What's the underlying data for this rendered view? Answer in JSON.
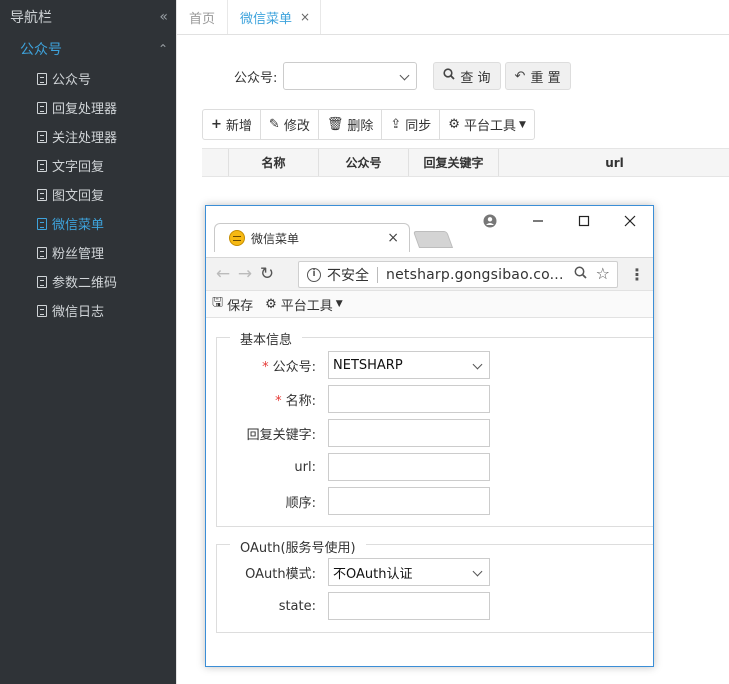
{
  "sidebar": {
    "title": "导航栏",
    "collapse_icon": "«",
    "group": "公众号",
    "group_icon": "chevron-double-up-icon",
    "items": [
      {
        "label": "公众号"
      },
      {
        "label": "回复处理器"
      },
      {
        "label": "关注处理器"
      },
      {
        "label": "文字回复"
      },
      {
        "label": "图文回复"
      },
      {
        "label": "微信菜单",
        "active": true
      },
      {
        "label": "粉丝管理"
      },
      {
        "label": "参数二维码"
      },
      {
        "label": "微信日志"
      }
    ]
  },
  "tabs": [
    {
      "label": "首页"
    },
    {
      "label": "微信菜单",
      "active": true,
      "close": "×"
    }
  ],
  "search": {
    "label": "公众号:",
    "select_value": "",
    "query_button": "查 询",
    "reset_button": "重 置"
  },
  "toolbar": {
    "add": "新增",
    "edit": "修改",
    "delete": "删除",
    "sync": "同步",
    "platform": "平台工具"
  },
  "grid": {
    "columns": [
      "名称",
      "公众号",
      "回复关键字",
      "url"
    ]
  },
  "popup": {
    "tab_title": "微信菜单",
    "tab_close": "×",
    "security": "不安全",
    "url": "netsharp.gongsibao.co...",
    "toolbar": {
      "save": "保存",
      "platform": "平台工具"
    },
    "basic_legend": "基本信息",
    "fields": [
      {
        "label": "公众号:",
        "required": true,
        "value": "NETSHARP",
        "type": "select"
      },
      {
        "label": "名称:",
        "required": true,
        "value": "",
        "type": "text"
      },
      {
        "label": "回复关键字:",
        "required": false,
        "value": "",
        "type": "text"
      },
      {
        "label": "url:",
        "required": false,
        "value": "",
        "type": "text"
      },
      {
        "label": "顺序:",
        "required": false,
        "value": "",
        "type": "text"
      }
    ],
    "oauth_legend": "OAuth(服务号使用)",
    "oauth_fields": [
      {
        "label": "OAuth模式:",
        "value": "不OAuth认证",
        "type": "select"
      },
      {
        "label": "state:",
        "value": "",
        "type": "text"
      }
    ]
  },
  "colors": {
    "accent": "#3ea3dc",
    "sidebar_bg": "#2f3337",
    "popup_border": "#3b8ed6"
  }
}
